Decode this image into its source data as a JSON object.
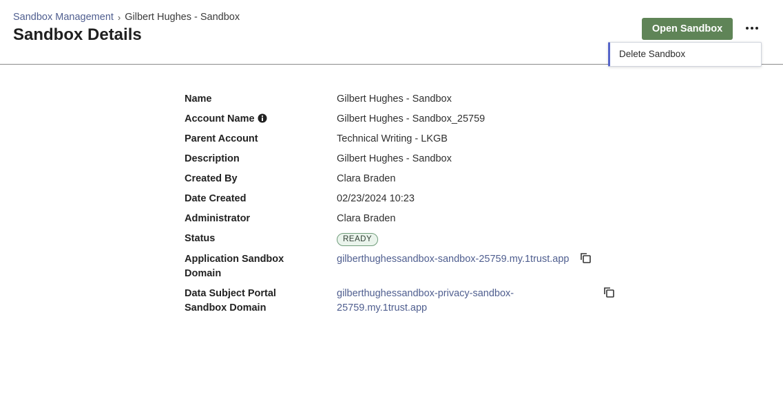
{
  "breadcrumb": {
    "parent": "Sandbox Management",
    "separator": "›",
    "current": "Gilbert Hughes - Sandbox"
  },
  "page": {
    "title": "Sandbox Details"
  },
  "actions": {
    "open_label": "Open Sandbox",
    "more_icon": "more-horizontal-icon",
    "menu": [
      "Delete Sandbox"
    ]
  },
  "details": {
    "name_label": "Name",
    "name_value": "Gilbert Hughes - Sandbox",
    "account_label": "Account Name",
    "account_value": "Gilbert Hughes - Sandbox_25759",
    "parent_label": "Parent Account",
    "parent_value": "Technical Writing - LKGB",
    "description_label": "Description",
    "description_value": "Gilbert Hughes - Sandbox",
    "created_by_label": "Created By",
    "created_by_value": "Clara Braden",
    "date_label": "Date Created",
    "date_value": "02/23/2024 10:23",
    "admin_label": "Administrator",
    "admin_value": "Clara Braden",
    "status_label": "Status",
    "status_value": "READY",
    "app_domain_label_1": "Application Sandbox",
    "app_domain_label_2": "Domain",
    "app_domain_value": "gilberthughessandbox-sandbox-25759.my.1trust.app",
    "dsp_domain_label_1": "Data Subject Portal",
    "dsp_domain_label_2": "Sandbox Domain",
    "dsp_domain_value_1": "gilberthughessandbox-privacy-sandbox-",
    "dsp_domain_value_2": "25759.my.1trust.app"
  },
  "colors": {
    "accent": "#5f8457",
    "link": "#4f5e8f",
    "menu_accent": "#5665c9",
    "status_badge": "#eaf4ec"
  }
}
